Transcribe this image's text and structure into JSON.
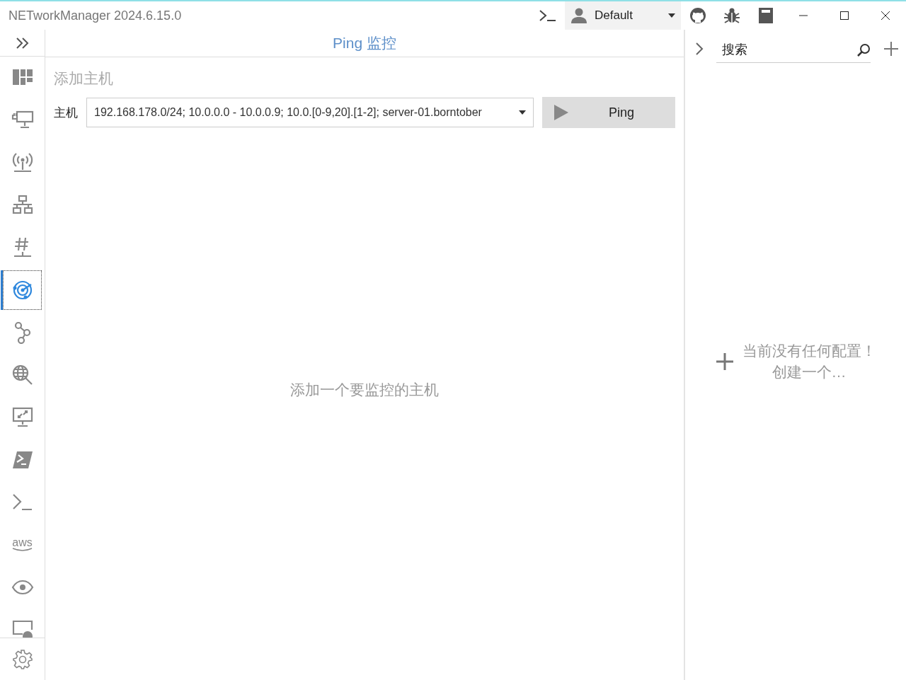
{
  "window": {
    "title": "NETworkManager 2024.6.15.0"
  },
  "titlebar": {
    "profile": "Default"
  },
  "sidebar": {
    "items": [
      {
        "selected": false
      },
      {
        "selected": false
      },
      {
        "selected": false
      },
      {
        "selected": false
      },
      {
        "selected": false
      },
      {
        "selected": true
      },
      {
        "selected": false
      },
      {
        "selected": false
      },
      {
        "selected": false
      },
      {
        "selected": false
      },
      {
        "selected": false
      },
      {
        "selected": false,
        "logo_text": "aws"
      },
      {
        "selected": false
      },
      {
        "selected": false
      }
    ]
  },
  "main": {
    "header": "Ping 监控",
    "section_title": "添加主机",
    "host_label": "主机",
    "host_value": "192.168.178.0/24; 10.0.0.0 - 10.0.0.9; 10.0.[0-9,20].[1-2]; server-01.borntober",
    "button": "Ping",
    "empty_message": "添加一个要监控的主机"
  },
  "profiles": {
    "search_placeholder": "搜索",
    "empty_line_1": "当前没有任何配置！",
    "empty_line_2": "创建一个…"
  }
}
